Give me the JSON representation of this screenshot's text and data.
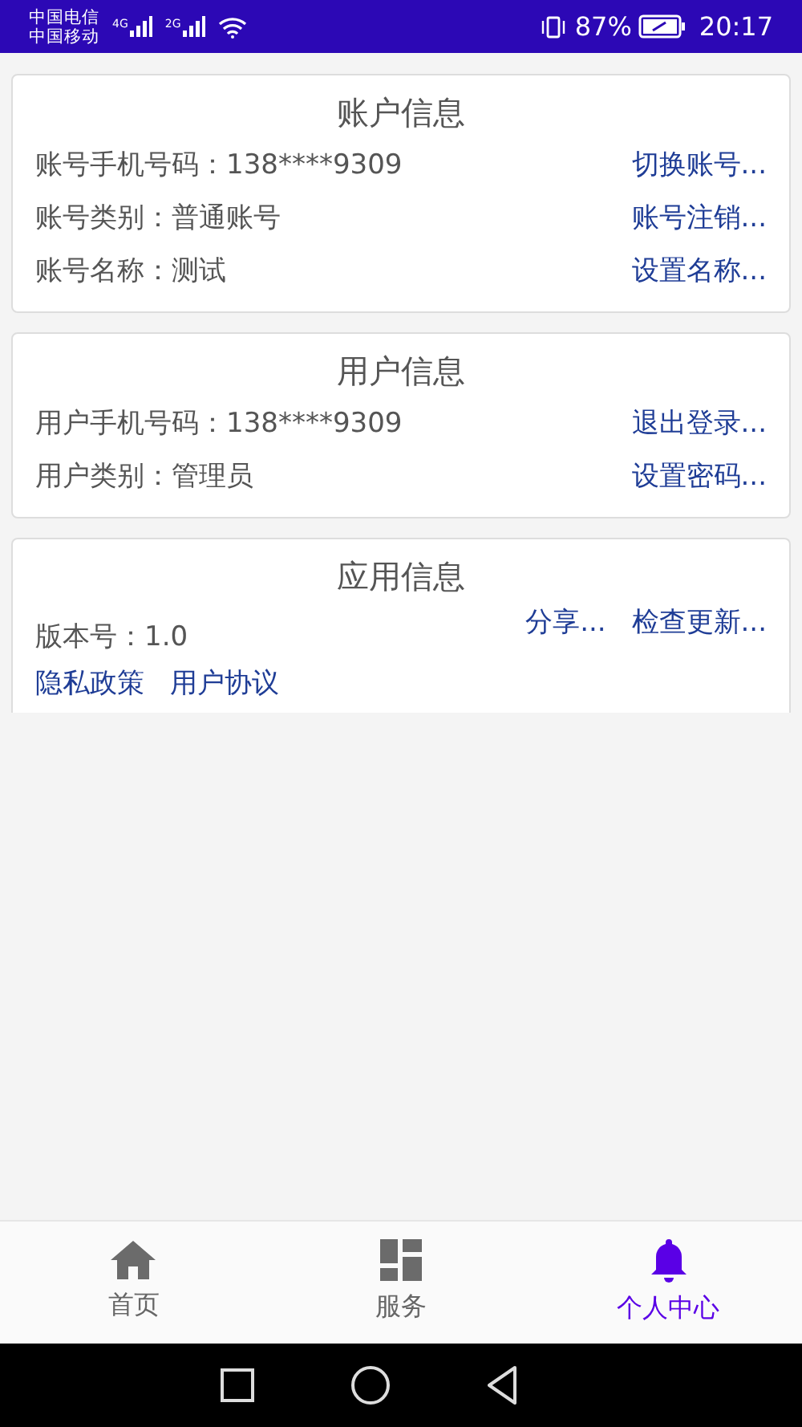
{
  "status_bar": {
    "carriers": [
      "中国电信",
      "中国移动"
    ],
    "network_labels": [
      "4G",
      "2G"
    ],
    "battery": "87%",
    "time": "20:17"
  },
  "cards": [
    {
      "kind": "info",
      "title": "账户信息",
      "rows": [
        {
          "text": "账号手机号码：138****9309",
          "action": "切换账号..."
        },
        {
          "text": "账号类别：普通账号",
          "action": "账号注销..."
        },
        {
          "text": "账号名称：测试",
          "action": "设置名称..."
        }
      ]
    },
    {
      "kind": "info",
      "title": "用户信息",
      "rows": [
        {
          "text": "用户手机号码：138****9309",
          "action": "退出登录..."
        },
        {
          "text": "用户类别：管理员",
          "action": "设置密码..."
        }
      ]
    },
    {
      "kind": "app",
      "title": "应用信息",
      "version": "版本号：1.0",
      "actions": [
        "分享...",
        "检查更新..."
      ],
      "links": [
        "隐私政策",
        "用户协议"
      ]
    }
  ],
  "bottom_nav": [
    {
      "label": "首页",
      "selected": false
    },
    {
      "label": "服务",
      "selected": false
    },
    {
      "label": "个人中心",
      "selected": true
    }
  ]
}
